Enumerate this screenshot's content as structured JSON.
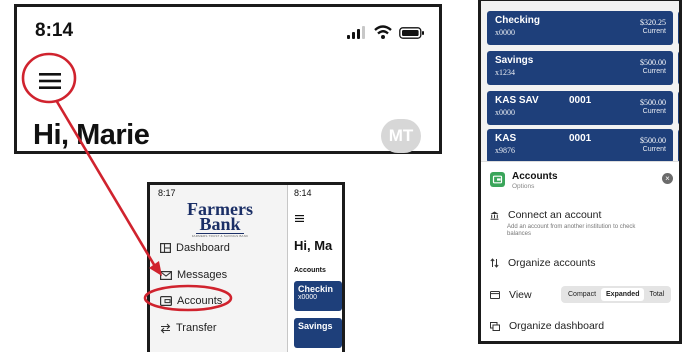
{
  "left_phone": {
    "time": "8:14",
    "greeting": "Hi, Marie",
    "avatar_initials": "MT"
  },
  "menu_crop": {
    "time_left": "8:17",
    "time_right": "8:14",
    "bank_name_line1": "Farmers",
    "bank_name_line2": "Bank",
    "bank_tagline": "FARMERS TRUST & SAVINGS BANK",
    "items": [
      {
        "label": "Dashboard",
        "icon": "dashboard-icon"
      },
      {
        "label": "Messages",
        "icon": "envelope-icon"
      },
      {
        "label": "Accounts",
        "icon": "wallet-icon"
      },
      {
        "label": "Transfer",
        "icon": "transfer-icon"
      }
    ],
    "greeting_peek": "Hi, Ma",
    "accounts_label": "Accounts",
    "card1_name": "Checkin",
    "card1_num": "x0000",
    "card2_name": "Savings"
  },
  "right_phone": {
    "accounts": [
      {
        "name": "Checking",
        "number": "x0000",
        "middle": "",
        "amount": "$320.25",
        "status": "Current"
      },
      {
        "name": "Savings",
        "number": "x1234",
        "middle": "",
        "amount": "$500.00",
        "status": "Current"
      },
      {
        "name": "KAS SAV",
        "number": "x0000",
        "middle": "0001",
        "amount": "$500.00",
        "status": "Current"
      },
      {
        "name": "KAS",
        "number": "x9876",
        "middle": "0001",
        "amount": "$500.00",
        "status": "Current"
      }
    ],
    "sheet": {
      "title": "Accounts",
      "subtitle": "Options",
      "connect_label": "Connect an account",
      "connect_desc": "Add an account from another institution to check balances",
      "organize_accounts": "Organize accounts",
      "view_label": "View",
      "view_options": [
        "Compact",
        "Expanded",
        "Total"
      ],
      "view_selected": "Expanded",
      "organize_dashboard": "Organize dashboard"
    }
  },
  "colors": {
    "navy": "#1e3f7a",
    "annotation_red": "#d0232e",
    "accounts_icon_green": "#3aa55a"
  }
}
